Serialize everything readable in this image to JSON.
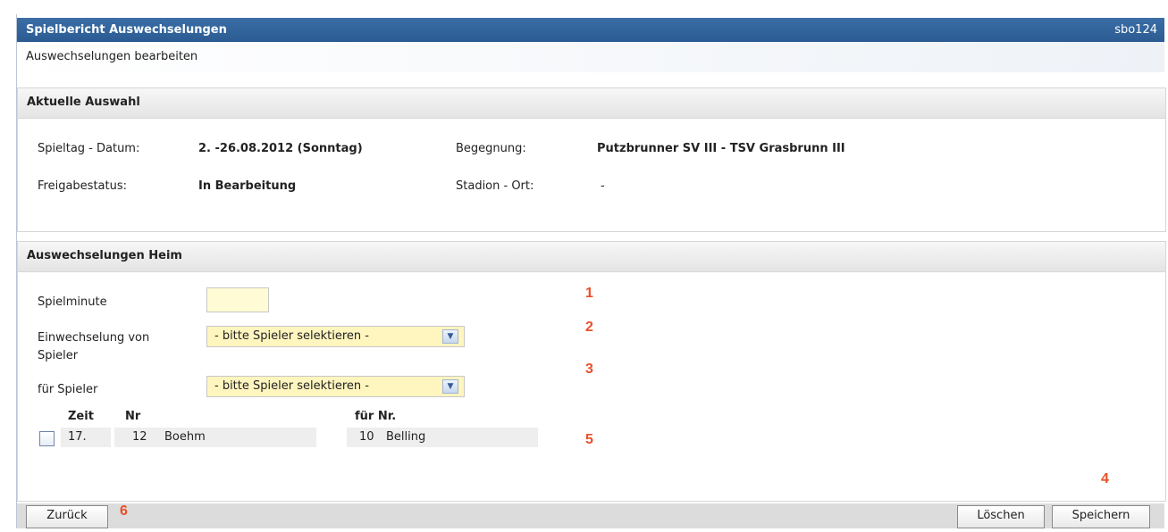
{
  "window": {
    "title": "Spielbericht Auswechselungen",
    "code": "sbo124",
    "subtitle": "Auswechselungen bearbeiten"
  },
  "selection": {
    "header": "Aktuelle Auswahl",
    "spieltag_label": "Spieltag - Datum:",
    "spieltag_value": "2. -26.08.2012 (Sonntag)",
    "begegnung_label": "Begegnung:",
    "begegnung_value": "Putzbrunner SV III - TSV Grasbrunn III",
    "freigabe_label": "Freigabestatus:",
    "freigabe_value": "In Bearbeitung",
    "stadion_label": "Stadion - Ort:",
    "stadion_value": "-"
  },
  "home": {
    "header": "Auswechselungen Heim",
    "spielminute_label": "Spielminute",
    "spielminute_value": "",
    "einwechselung_label_1": "Einwechselung von",
    "einwechselung_label_2": "Spieler",
    "einwechselung_value": "- bitte Spieler selektieren -",
    "fuer_spieler_label": "für Spieler",
    "fuer_spieler_value": "- bitte Spieler selektieren -",
    "table": {
      "headers": {
        "zeit": "Zeit",
        "nr": "Nr",
        "fuer_nr": "für Nr."
      },
      "rows": [
        {
          "zeit": "17.",
          "nr": "12",
          "name": "Boehm",
          "fuer_nr": "10",
          "fuer_name": "Belling"
        }
      ]
    }
  },
  "footer": {
    "back_label": "Zurück",
    "delete_label": "Löschen",
    "save_label": "Speichern"
  },
  "annotations": {
    "n1": "1",
    "n2": "2",
    "n3": "3",
    "n4": "4",
    "n5": "5",
    "n6": "6"
  },
  "colors": {
    "title_bar": "#2b5b92",
    "input_yellow": "#fffbd4",
    "annotation": "#e8502a"
  }
}
